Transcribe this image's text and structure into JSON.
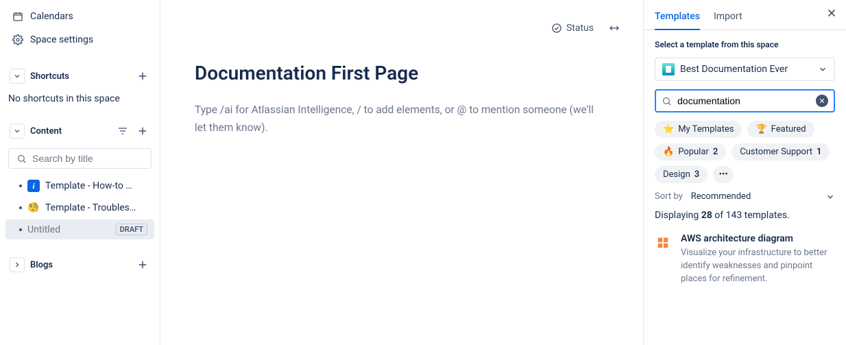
{
  "sidebar": {
    "nav": {
      "calendars": "Calendars",
      "space_settings": "Space settings"
    },
    "shortcuts": {
      "title": "Shortcuts",
      "empty": "No shortcuts in this space"
    },
    "content": {
      "title": "Content",
      "search_placeholder": "Search by title",
      "items": [
        {
          "emoji_type": "info",
          "label": "Template - How-to …"
        },
        {
          "emoji_type": "mag",
          "label": "Template - Troubles…"
        },
        {
          "emoji_type": "none",
          "label": "Untitled",
          "draft": "DRAFT",
          "active": true
        }
      ]
    },
    "blogs": {
      "title": "Blogs"
    }
  },
  "main": {
    "status": "Status",
    "title": "Documentation First Page",
    "placeholder": "Type /ai for Atlassian Intelligence, / to add elements, or @ to mention someone (we'll let them know)."
  },
  "panel": {
    "tabs": {
      "templates": "Templates",
      "import": "Import"
    },
    "select_label": "Select a template from this space",
    "space_name": "Best Documentation Ever",
    "search_value": "documentation",
    "chips": {
      "my_templates": "My Templates",
      "featured": "Featured",
      "popular": "Popular",
      "popular_count": "2",
      "customer_support": "Customer Support",
      "customer_support_count": "1",
      "design": "Design",
      "design_count": "3"
    },
    "sort": {
      "label": "Sort by",
      "value": "Recommended"
    },
    "results": {
      "prefix": "Displaying ",
      "count": "28",
      "mid": " of 143 templates."
    },
    "template": {
      "title": "AWS architecture diagram",
      "desc": "Visualize your infrastructure to better identify weaknesses and pinpoint places for refinement."
    }
  }
}
